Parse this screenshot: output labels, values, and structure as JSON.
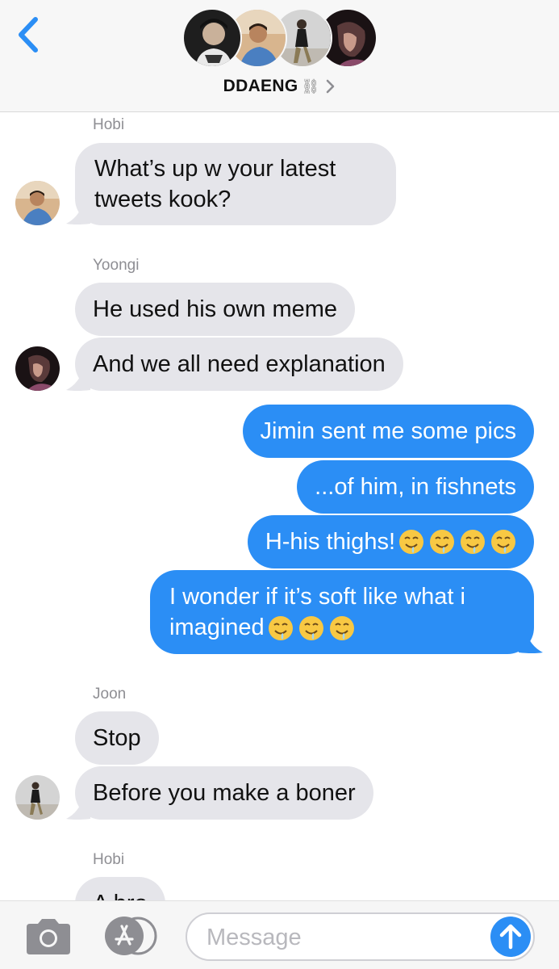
{
  "header": {
    "group_name": "DDAENG",
    "group_emoji": "⛓",
    "avatars": [
      "avatar-1",
      "avatar-2",
      "avatar-3",
      "avatar-4"
    ]
  },
  "icons": {
    "back": "chevron-left-icon",
    "details": "chevron-right-icon",
    "camera": "camera-icon",
    "apps": "app-store-icon",
    "send": "arrow-up-icon",
    "reaction_emoji": "drooling-face-emoji"
  },
  "colors": {
    "accent": "#2b8ef5",
    "received_bubble": "#e5e5ea",
    "sender_label": "#8e8e93"
  },
  "messages": [
    {
      "sender": "Hobi",
      "text": "What’s up w your latest tweets kook?"
    },
    {
      "sender": "Yoongi",
      "text": "He used his own meme"
    },
    {
      "text": "And we all need explanation"
    },
    {
      "text": "Jimin sent me some pics",
      "outgoing": true
    },
    {
      "text": "...of him, in fishnets",
      "outgoing": true
    },
    {
      "text": "H-his thighs!",
      "outgoing": true,
      "emoji_count": 4
    },
    {
      "text": "I wonder if it’s soft like what i imagined",
      "outgoing": true,
      "emoji_count": 3
    },
    {
      "sender": "Joon",
      "text": "Stop"
    },
    {
      "text": "Before you make a boner"
    },
    {
      "sender": "Hobi",
      "text": "A bro"
    }
  ],
  "input": {
    "placeholder": "Message",
    "value": ""
  }
}
